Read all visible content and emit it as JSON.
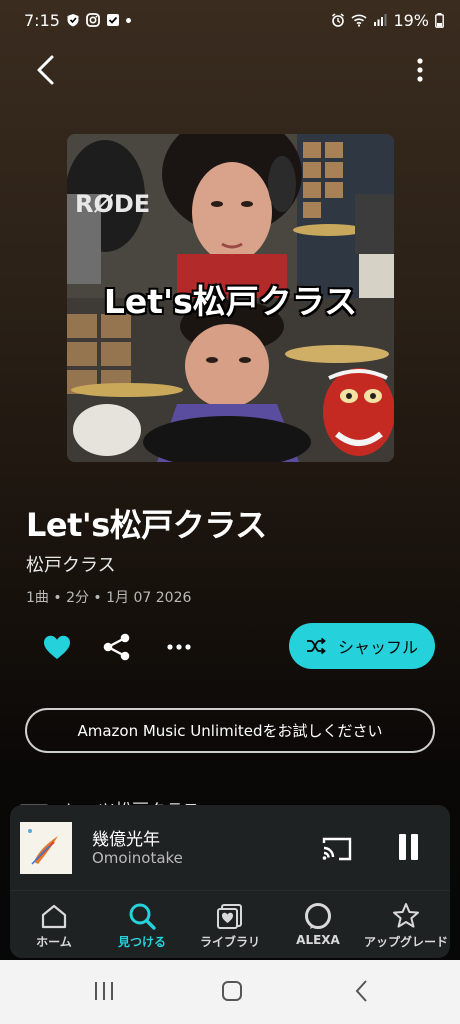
{
  "status_bar": {
    "time": "7:15",
    "battery": "19%"
  },
  "album": {
    "art_title": "Let's松戸クラス",
    "art_logo": "RØDE",
    "title": "Let's松戸クラス",
    "artist": "松戸クラス",
    "meta": "1曲 • 2分 • 1月 07 2026"
  },
  "actions": {
    "shuffle_label": "シャッフル",
    "trial_label": "Amazon Music Unlimitedをお試しください"
  },
  "track_list": [
    {
      "title": "レッツ松戸クラス"
    }
  ],
  "now_playing": {
    "title": "幾億光年",
    "artist": "Omoinotake"
  },
  "bottom_nav": [
    {
      "label": "ホーム",
      "icon": "home-icon"
    },
    {
      "label": "見つける",
      "icon": "search-icon",
      "active": true
    },
    {
      "label": "ライブラリ",
      "icon": "library-icon"
    },
    {
      "label": "ALEXA",
      "icon": "alexa-icon"
    },
    {
      "label": "アップグレード",
      "icon": "star-icon"
    }
  ],
  "colors": {
    "accent": "#25d1da",
    "background": "#2b2117",
    "card": "#1f2223"
  }
}
